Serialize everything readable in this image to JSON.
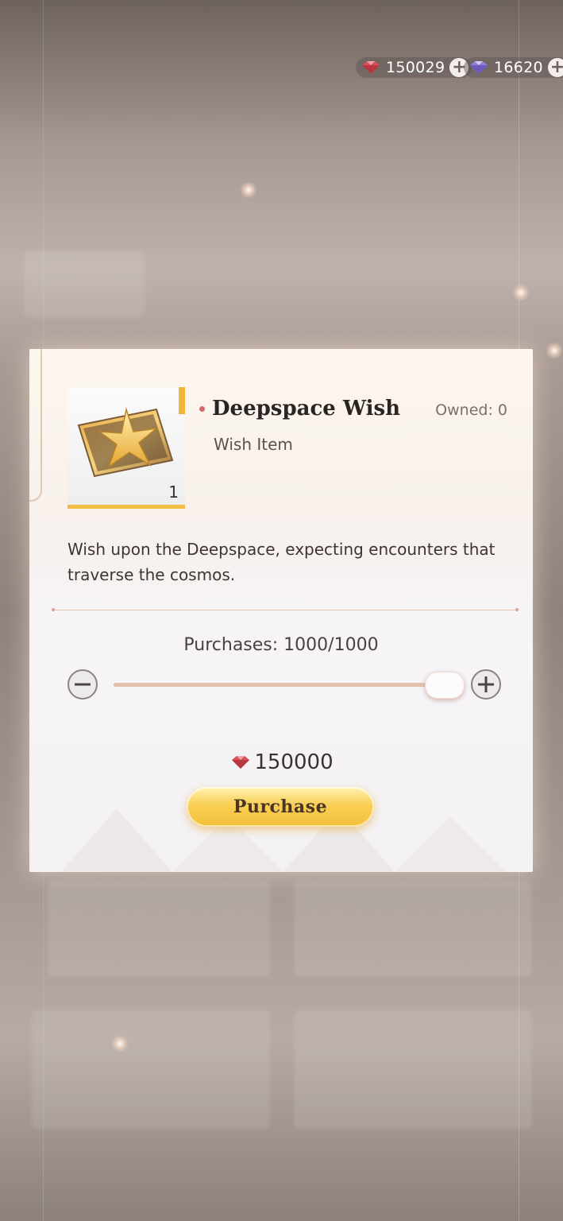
{
  "currency": {
    "diamonds": "150029",
    "crystals": "16620",
    "diamond_icon": "red-diamond-icon",
    "crystal_icon": "purple-crystal-icon"
  },
  "modal": {
    "item_name": "Deepspace Wish",
    "item_type": "Wish Item",
    "owned": "Owned: 0",
    "item_count": "1",
    "item_icon": "wish-star-ticket-icon",
    "description": "Wish upon the Deepspace, expecting encounters that traverse the cosmos.",
    "purchases_label": "Purchases: 1000/1000",
    "purchases_current": 1000,
    "purchases_max": 1000,
    "price": "150000",
    "purchase_button": "Purchase"
  },
  "colors": {
    "accent_gold": "#f4bf3a",
    "gem_red": "#d8505a",
    "bullet_red": "#d4686a"
  }
}
